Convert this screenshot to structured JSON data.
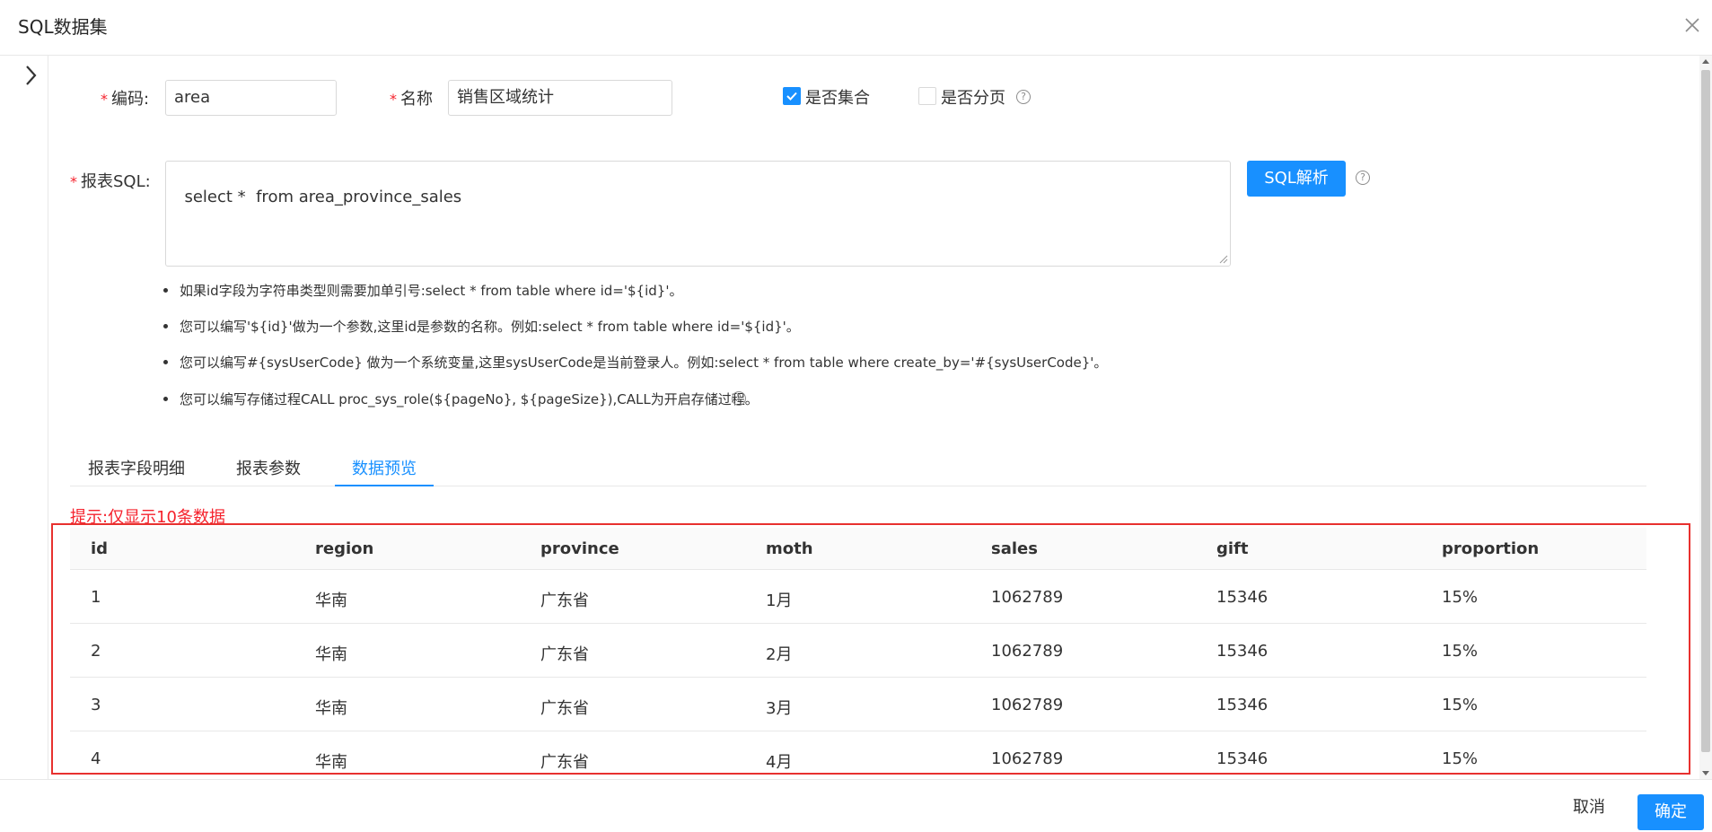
{
  "dialog": {
    "title": "SQL数据集"
  },
  "form": {
    "code_label": "编码:",
    "code_value": "area",
    "name_label": "名称",
    "name_value": "销售区域统计",
    "is_set_label": "是否集合",
    "is_set_checked": true,
    "is_paged_label": "是否分页",
    "is_paged_checked": false,
    "sql_label": "报表SQL:",
    "sql_value": "select *  from area_province_sales",
    "parse_button": "SQL解析",
    "required_mark": "*",
    "help_glyph": "?"
  },
  "tips": [
    "如果id字段为字符串类型则需要加单引号:select * from table where id='${id}'。",
    "您可以编写'${id}'做为一个参数,这里id是参数的名称。例如:select * from table where id='${id}'。",
    "您可以编写#{sysUserCode} 做为一个系统变量,这里sysUserCode是当前登录人。例如:select * from table where create_by='#{sysUserCode}'。",
    "您可以编写存储过程CALL proc_sys_role(${pageNo}, ${pageSize}),CALL为开启存储过程。"
  ],
  "tabs": [
    {
      "label": "报表字段明细",
      "active": false
    },
    {
      "label": "报表参数",
      "active": false
    },
    {
      "label": "数据预览",
      "active": true
    }
  ],
  "notice": "提示:仅显示10条数据",
  "table": {
    "columns": [
      "id",
      "region",
      "province",
      "moth",
      "sales",
      "gift",
      "proportion"
    ],
    "rows": [
      [
        "1",
        "华南",
        "广东省",
        "1月",
        "1062789",
        "15346",
        "15%"
      ],
      [
        "2",
        "华南",
        "广东省",
        "2月",
        "1062789",
        "15346",
        "15%"
      ],
      [
        "3",
        "华南",
        "广东省",
        "3月",
        "1062789",
        "15346",
        "15%"
      ],
      [
        "4",
        "华南",
        "广东省",
        "4月",
        "1062789",
        "15346",
        "15%"
      ]
    ]
  },
  "footer": {
    "cancel_label": "取消",
    "ok_label": "确定"
  },
  "colors": {
    "primary": "#1890ff",
    "highlight": "#e8312f",
    "notice": "#f5222d"
  }
}
